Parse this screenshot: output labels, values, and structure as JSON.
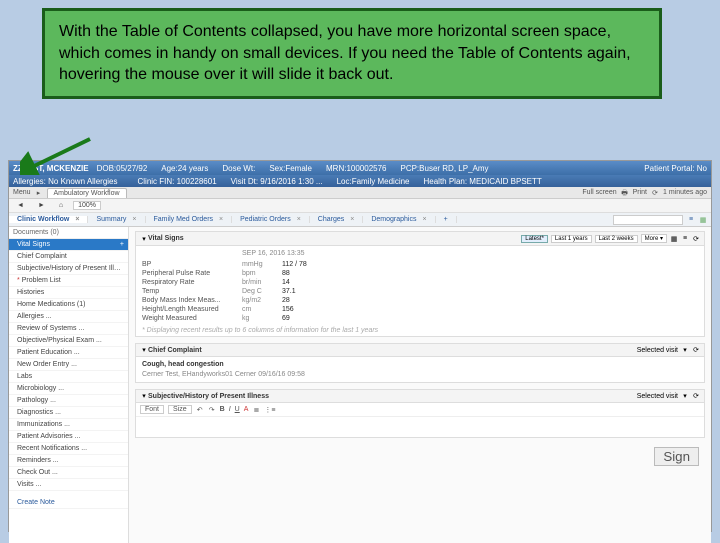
{
  "callout_text": "With the Table of Contents collapsed, you have more horizontal screen space, which comes in handy on small devices. If you need the Table of Contents again, hovering the mouse over it will slide it back out.",
  "patient": {
    "name": "ZZTEST, MCKENZIE",
    "allergies": "Allergies: No Known Allergies",
    "dob": "DOB:05/27/92",
    "age": "Age:24 years",
    "dose_wt": "Dose Wt:",
    "sex": "Sex:Female",
    "mrn": "MRN:100002576",
    "pcp": "PCP:Buser RD, LP_Amy",
    "clinic_fin": "Clinic FIN: 100228601",
    "visit_dt": "Visit Dt: 9/16/2016 1:30 ...",
    "loc": "Loc:Family Medicine",
    "plan": "Health Plan: MEDICAID BPSETT",
    "portal": "Patient Portal: No"
  },
  "subbar": {
    "menu": "Menu",
    "workflow_tab": "Ambulatory Workflow",
    "fullscreen": "Full screen",
    "print": "Print",
    "refresh": "1 minutes ago"
  },
  "toolbar": {
    "nav_back": "◄",
    "nav_fwd": "►",
    "home": "⌂",
    "zoom": "100%"
  },
  "tabs": [
    {
      "label": "Clinic Workflow",
      "active": true
    },
    {
      "label": "Summary",
      "active": false
    },
    {
      "label": "Family Med Orders",
      "active": false
    },
    {
      "label": "Pediatric Orders",
      "active": false
    },
    {
      "label": "Charges",
      "active": false
    },
    {
      "label": "Demographics",
      "active": false
    }
  ],
  "tabs_add": "+",
  "toc": {
    "header": "Documents (0)",
    "items": [
      {
        "label": "Vital Signs",
        "active": true
      },
      {
        "label": "Chief Complaint"
      },
      {
        "label": "Subjective/History of Present Illness"
      },
      {
        "label": "Problem List",
        "star": true
      },
      {
        "label": "Histories"
      },
      {
        "label": "Home Medications (1)"
      },
      {
        "label": "Allergies ..."
      },
      {
        "label": "Review of Systems ..."
      },
      {
        "label": "Objective/Physical Exam ..."
      },
      {
        "label": "Patient Education ..."
      },
      {
        "label": "New Order Entry ..."
      },
      {
        "label": "Labs"
      },
      {
        "label": "Microbiology ..."
      },
      {
        "label": "Pathology ..."
      },
      {
        "label": "Diagnostics ..."
      },
      {
        "label": "Immunizations ..."
      },
      {
        "label": "Patient Advisories ..."
      },
      {
        "label": "Recent Notifications ..."
      },
      {
        "label": "Reminders ..."
      },
      {
        "label": "Check Out ..."
      },
      {
        "label": "Visits ..."
      }
    ],
    "create_note": "Create Note"
  },
  "vital_signs": {
    "title": "Vital Signs",
    "filters": {
      "latest": "Latest*",
      "last1": "Last 1 years",
      "last2": "Last 2 weeks",
      "more": "More ▾"
    },
    "date": "SEP 16, 2016 13:35",
    "rows": [
      {
        "label": "BP",
        "unit": "mmHg",
        "val": "112 / 78"
      },
      {
        "label": "Peripheral Pulse Rate",
        "unit": "bpm",
        "val": "88"
      },
      {
        "label": "Respiratory Rate",
        "unit": "br/min",
        "val": "14"
      },
      {
        "label": "Temp",
        "unit": "Deg C",
        "val": "37.1"
      },
      {
        "label": "Body Mass Index Meas...",
        "unit": "kg/m2",
        "val": "28"
      },
      {
        "label": "Height/Length Measured",
        "unit": "cm",
        "val": "156"
      },
      {
        "label": "Weight Measured",
        "unit": "kg",
        "val": "69"
      }
    ],
    "note": "* Displaying recent results up to 6 columns of information for the last 1 years"
  },
  "chief_complaint": {
    "title": "Chief Complaint",
    "selected_visit": "Selected visit",
    "text": "Cough, head congestion",
    "meta": "Cerner Test, EHandyworks01 Cerner   09/16/16 09:58"
  },
  "hpi": {
    "title": "Subjective/History of Present Illness",
    "selected_visit": "Selected visit",
    "rte": {
      "font": "Font",
      "size": "Size",
      "bold": "B",
      "italic": "I",
      "underline": "U",
      "color": "A"
    }
  },
  "sign_label": "Sign"
}
